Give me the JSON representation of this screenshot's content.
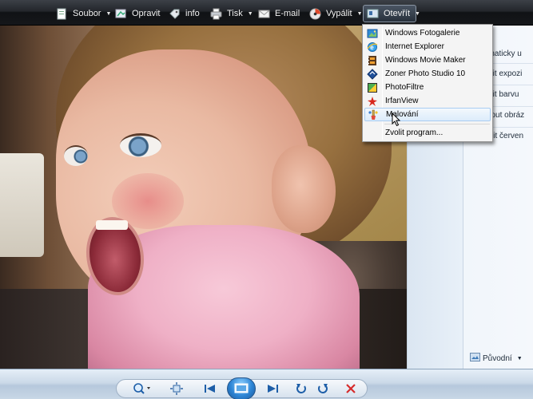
{
  "toolbar": {
    "items": [
      {
        "label": "Soubor",
        "icon": "file-icon",
        "dropdown": true
      },
      {
        "label": "Opravit",
        "icon": "fix-icon",
        "dropdown": false
      },
      {
        "label": "info",
        "icon": "info-tag-icon",
        "dropdown": false
      },
      {
        "label": "Tisk",
        "icon": "printer-icon",
        "dropdown": true
      },
      {
        "label": "E-mail",
        "icon": "email-icon",
        "dropdown": false
      },
      {
        "label": "Vypálit",
        "icon": "burn-disc-icon",
        "dropdown": true
      },
      {
        "label": "Otevřít",
        "icon": "open-with-icon",
        "dropdown": true
      }
    ]
  },
  "menu": {
    "items": [
      {
        "label": "Windows Fotogalerie",
        "icon": "photo-gallery-icon"
      },
      {
        "label": "Internet Explorer",
        "icon": "internet-explorer-icon"
      },
      {
        "label": "Windows Movie Maker",
        "icon": "movie-maker-icon"
      },
      {
        "label": "Zoner Photo Studio 10",
        "icon": "zoner-icon"
      },
      {
        "label": "PhotoFiltre",
        "icon": "photofiltre-icon"
      },
      {
        "label": "IrfanView",
        "icon": "irfanview-icon"
      },
      {
        "label": "Malování",
        "icon": "paint-icon",
        "hovered": true
      }
    ],
    "choose_program": "Zvolit program..."
  },
  "fix_pane": {
    "items": [
      "Automaticky u",
      "Upravit expozi",
      "Upravit barvu",
      "Oříznout obráz",
      "Opravit červen"
    ],
    "view_select": "Původní"
  },
  "colors": {
    "toolbar_top": "#3c4047",
    "toolbar_bottom": "#101215",
    "menu_hover": "#dcecfb",
    "bottombar": "#cbd9e8",
    "delete": "#d62b2b"
  }
}
